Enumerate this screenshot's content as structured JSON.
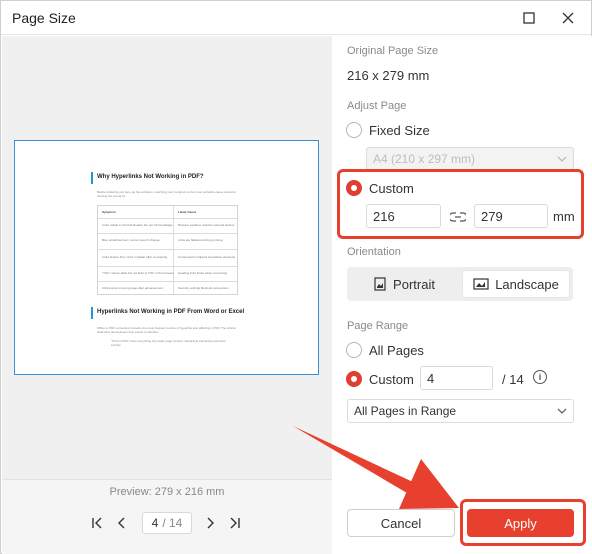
{
  "dialog": {
    "title": "Page Size"
  },
  "preview": {
    "doc_heading_1": "Why Hyperlinks Not Working in PDF?",
    "doc_heading_2": "Hyperlinks Not Working in PDF From Word or Excel",
    "doc_intro": "Before following you here go the solutions, matching your symptom to the most probable cause prevents chasing the wrong fix.",
    "table_headers": [
      "Symptom",
      "Likely Cause"
    ],
    "table_rows": [
      [
        "Links visible in Acrobat Reader but not Chrome/Edge",
        "Browser sandbox restricts external actions"
      ],
      [
        "Blue underlined text, cursor doesn't change",
        "Links are flattened during printing"
      ],
      [
        "Links broken then, links in Safari after re-opening",
        "Compression stripped annotation elements"
      ],
      [
        "\"TOC\" shows table but not links to TOC in the browser",
        "Heading links broke when converting"
      ],
      [
        "Click points to wrong page after advancement",
        "Security settings block all connections"
      ]
    ],
    "doc_para": "Office to PDF conversion remains the most frequent source of hyperlink loss affecting 1 PDF. The critical distinction lies between how export is handled.",
    "doc_bullet": "\"Print to PDF\" fixes everything into static page content, discarding interactive elements entirely.",
    "preview_label": "Preview: 279 x 216 mm",
    "current_page": "4",
    "total_pages": "/ 14"
  },
  "settings": {
    "original_size_label": "Original Page Size",
    "original_size_value": "216 x 279 mm",
    "adjust_label": "Adjust Page",
    "fixed_size_label": "Fixed Size",
    "fixed_size_select": "A4 (210 x 297 mm)",
    "custom_label": "Custom",
    "width_value": "216",
    "height_value": "279",
    "unit": "mm",
    "orientation_label": "Orientation",
    "portrait_label": "Portrait",
    "landscape_label": "Landscape",
    "range_label": "Page Range",
    "all_pages_label": "All Pages",
    "range_custom_label": "Custom",
    "range_value": "4",
    "range_total": "/ 14",
    "range_select": "All Pages in Range",
    "cancel_label": "Cancel",
    "apply_label": "Apply"
  },
  "colors": {
    "accent": "#e8402f",
    "preview_border": "#3a8fd9"
  }
}
